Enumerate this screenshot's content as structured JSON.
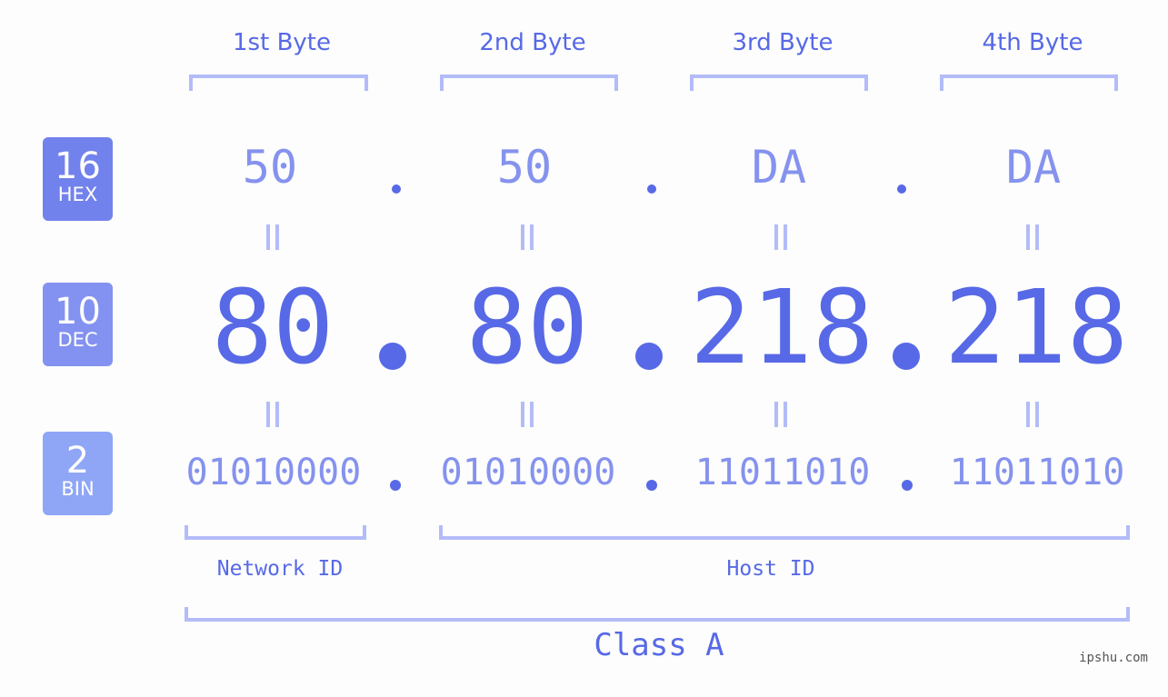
{
  "ip": {
    "hex": [
      "50",
      "50",
      "DA",
      "DA"
    ],
    "dec": [
      "80",
      "80",
      "218",
      "218"
    ],
    "bin": [
      "01010000",
      "01010000",
      "11011010",
      "11011010"
    ],
    "separator": "."
  },
  "byte_headers": [
    "1st Byte",
    "2nd Byte",
    "3rd Byte",
    "4th Byte"
  ],
  "bases": [
    {
      "num": "16",
      "label": "HEX",
      "color": "#7282ec"
    },
    {
      "num": "10",
      "label": "DEC",
      "color": "#8392f0"
    },
    {
      "num": "2",
      "label": "BIN",
      "color": "#8fa6f6"
    }
  ],
  "segments": {
    "network": "Network ID",
    "host": "Host ID",
    "class": "Class A"
  },
  "watermark": "ipshu.com",
  "colors": {
    "primary": "#5769e6",
    "light": "#8592ee",
    "bracket": "#b3bcf8",
    "background": "#fcfdfc"
  }
}
